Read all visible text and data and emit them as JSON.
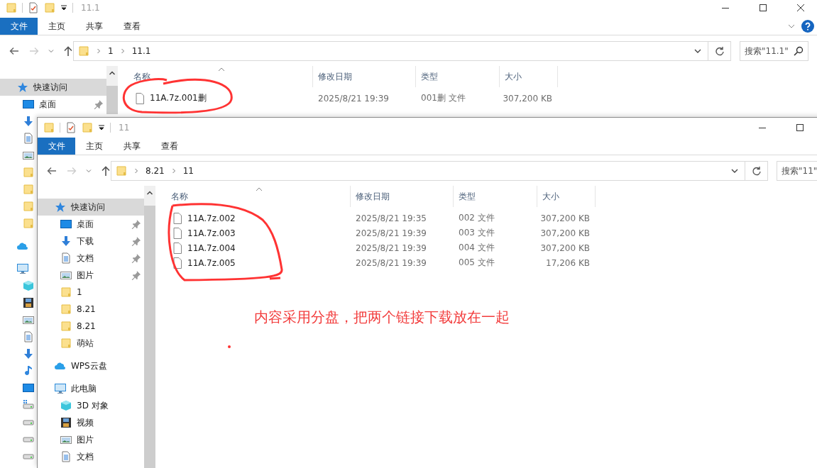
{
  "windows": [
    {
      "title": "11.1",
      "ribbon_tabs": [
        {
          "label": "文件",
          "kind": "file"
        },
        {
          "label": "主页",
          "kind": "tab"
        },
        {
          "label": "共享",
          "kind": "tab"
        },
        {
          "label": "查看",
          "kind": "tab"
        }
      ],
      "path": [
        "1",
        "11.1"
      ],
      "search": {
        "placeholder": "搜索\"11.1\""
      },
      "sidebar": [
        {
          "label": "快速访问",
          "kind": "star",
          "selected": true,
          "children": [
            {
              "label": "桌面",
              "kind": "desktop",
              "selected": false,
              "pinned": true
            },
            {
              "kind": "download",
              "selected": false
            },
            {
              "kind": "doc",
              "selected": false
            },
            {
              "kind": "picture",
              "selected": false
            },
            {
              "kind": "folder",
              "selected": false
            },
            {
              "kind": "folder",
              "selected": false
            },
            {
              "kind": "folder",
              "selected": false
            },
            {
              "kind": "folder",
              "selected": false
            }
          ]
        },
        {
          "kind": "cloud",
          "selected": false
        },
        {
          "kind": "pc",
          "selected": false,
          "children": [
            {
              "kind": "cube",
              "selected": false
            },
            {
              "kind": "video",
              "selected": false
            },
            {
              "kind": "picture",
              "selected": false
            },
            {
              "kind": "doc",
              "selected": false
            },
            {
              "kind": "download",
              "selected": false
            },
            {
              "kind": "music",
              "selected": false
            },
            {
              "kind": "desktop",
              "selected": false
            },
            {
              "kind": "drive-win",
              "selected": false
            },
            {
              "kind": "drive",
              "selected": false
            },
            {
              "kind": "drive",
              "selected": false
            },
            {
              "kind": "drive",
              "selected": false
            }
          ]
        }
      ],
      "columns": [
        "名称",
        "修改日期",
        "类型",
        "大小"
      ],
      "files": [
        {
          "name": "11A.7z.001删",
          "date": "2025/8/21 19:39",
          "type": "001删 文件",
          "size": "307,200 KB"
        }
      ]
    },
    {
      "title": "11",
      "ribbon_tabs": [
        {
          "label": "文件",
          "kind": "file"
        },
        {
          "label": "主页",
          "kind": "tab"
        },
        {
          "label": "共享",
          "kind": "tab"
        },
        {
          "label": "查看",
          "kind": "tab"
        }
      ],
      "path": [
        "8.21",
        "11"
      ],
      "search": {
        "placeholder": "搜索\"11\""
      },
      "sidebar": [
        {
          "label": "快速访问",
          "kind": "star",
          "selected": true,
          "children": [
            {
              "label": "桌面",
              "kind": "desktop",
              "selected": false,
              "pinned": true
            },
            {
              "label": "下载",
              "kind": "download",
              "selected": false,
              "pinned": true
            },
            {
              "label": "文档",
              "kind": "doc",
              "selected": false,
              "pinned": true
            },
            {
              "label": "图片",
              "kind": "picture",
              "selected": false,
              "pinned": true
            },
            {
              "label": "1",
              "kind": "folder",
              "selected": false,
              "pinned": false
            },
            {
              "label": "8.21",
              "kind": "folder",
              "selected": false,
              "pinned": false
            },
            {
              "label": "8.21",
              "kind": "folder",
              "selected": false,
              "pinned": false
            },
            {
              "label": "萌站",
              "kind": "folder",
              "selected": false,
              "pinned": false
            }
          ]
        },
        {
          "label": "WPS云盘",
          "kind": "cloud",
          "selected": false
        },
        {
          "label": "此电脑",
          "kind": "pc",
          "selected": false,
          "children": [
            {
              "label": "3D 对象",
              "kind": "cube",
              "selected": false
            },
            {
              "label": "视频",
              "kind": "video",
              "selected": false
            },
            {
              "label": "图片",
              "kind": "picture",
              "selected": false
            },
            {
              "label": "文档",
              "kind": "doc",
              "selected": false
            }
          ]
        }
      ],
      "columns": [
        "名称",
        "修改日期",
        "类型",
        "大小"
      ],
      "files": [
        {
          "name": "11A.7z.002",
          "date": "2025/8/21 19:35",
          "type": "002 文件",
          "size": "307,200 KB"
        },
        {
          "name": "11A.7z.003",
          "date": "2025/8/21 19:39",
          "type": "003 文件",
          "size": "307,200 KB"
        },
        {
          "name": "11A.7z.004",
          "date": "2025/8/21 19:39",
          "type": "004 文件",
          "size": "307,200 KB"
        },
        {
          "name": "11A.7z.005",
          "date": "2025/8/21 19:39",
          "type": "005 文件",
          "size": "17,206 KB"
        }
      ]
    }
  ],
  "annotation": "内容采用分盘，把两个链接下载放在一起"
}
